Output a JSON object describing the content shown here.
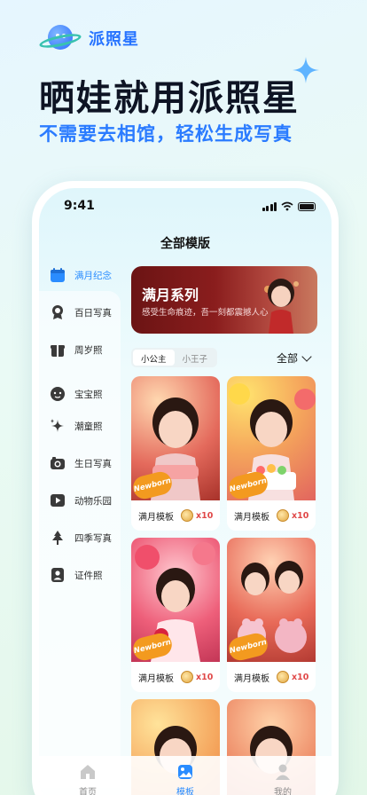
{
  "promo": {
    "brand_name": "派照星",
    "headline": "晒娃就用派照星",
    "subline": "不需要去相馆，轻松生成写真"
  },
  "status_bar": {
    "time": "9:41"
  },
  "page": {
    "title": "全部模版"
  },
  "sidebar": {
    "items": [
      {
        "label": "满月纪念",
        "icon": "calendar-icon",
        "active": true
      },
      {
        "label": "百日写真",
        "icon": "medal-icon"
      },
      {
        "label": "周岁照",
        "icon": "gift-icon"
      },
      {
        "label": "宝宝照",
        "icon": "baby-face-icon"
      },
      {
        "label": "潮童照",
        "icon": "sparkle-icon"
      },
      {
        "label": "生日写真",
        "icon": "camera-icon"
      },
      {
        "label": "动物乐园",
        "icon": "play-icon"
      },
      {
        "label": "四季写真",
        "icon": "tree-icon"
      },
      {
        "label": "证件照",
        "icon": "id-photo-icon"
      }
    ]
  },
  "banner": {
    "title": "满月系列",
    "subtitle": "感受生命痕迹，吾一刻都震撼人心"
  },
  "segment": {
    "options": [
      "小公主",
      "小王子"
    ],
    "selected": "小公主"
  },
  "filter": {
    "label": "全部"
  },
  "templates": [
    {
      "name": "满月模板",
      "price": "x10",
      "sticker": "Newborn"
    },
    {
      "name": "满月模板",
      "price": "x10",
      "sticker": "Newborn"
    },
    {
      "name": "满月模板",
      "price": "x10",
      "sticker": "Newborn"
    },
    {
      "name": "满月模板",
      "price": "x10",
      "sticker": "Newborn"
    }
  ],
  "tabbar": {
    "items": [
      {
        "label": "首页",
        "icon": "home-icon"
      },
      {
        "label": "模板",
        "icon": "image-icon",
        "active": true
      },
      {
        "label": "我的",
        "icon": "user-icon"
      }
    ]
  },
  "colors": {
    "accent": "#2a8cff",
    "brand": "#2673ff",
    "price": "#e04848"
  }
}
